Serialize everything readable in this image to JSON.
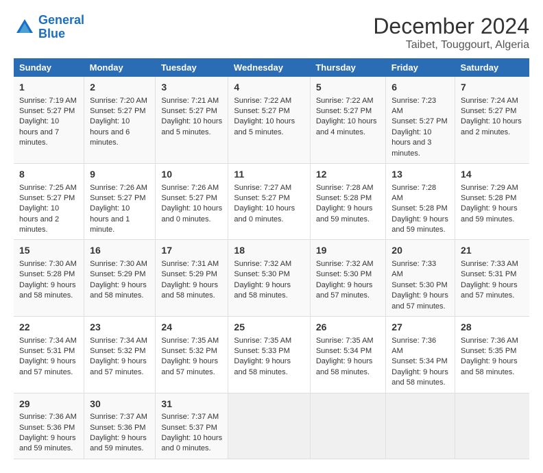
{
  "header": {
    "logo_line1": "General",
    "logo_line2": "Blue",
    "title": "December 2024",
    "subtitle": "Taibet, Touggourt, Algeria"
  },
  "days_of_week": [
    "Sunday",
    "Monday",
    "Tuesday",
    "Wednesday",
    "Thursday",
    "Friday",
    "Saturday"
  ],
  "weeks": [
    [
      {
        "day": "1",
        "sunrise": "7:19 AM",
        "sunset": "5:27 PM",
        "daylight": "10 hours and 7 minutes."
      },
      {
        "day": "2",
        "sunrise": "7:20 AM",
        "sunset": "5:27 PM",
        "daylight": "10 hours and 6 minutes."
      },
      {
        "day": "3",
        "sunrise": "7:21 AM",
        "sunset": "5:27 PM",
        "daylight": "10 hours and 5 minutes."
      },
      {
        "day": "4",
        "sunrise": "7:22 AM",
        "sunset": "5:27 PM",
        "daylight": "10 hours and 5 minutes."
      },
      {
        "day": "5",
        "sunrise": "7:22 AM",
        "sunset": "5:27 PM",
        "daylight": "10 hours and 4 minutes."
      },
      {
        "day": "6",
        "sunrise": "7:23 AM",
        "sunset": "5:27 PM",
        "daylight": "10 hours and 3 minutes."
      },
      {
        "day": "7",
        "sunrise": "7:24 AM",
        "sunset": "5:27 PM",
        "daylight": "10 hours and 2 minutes."
      }
    ],
    [
      {
        "day": "8",
        "sunrise": "7:25 AM",
        "sunset": "5:27 PM",
        "daylight": "10 hours and 2 minutes."
      },
      {
        "day": "9",
        "sunrise": "7:26 AM",
        "sunset": "5:27 PM",
        "daylight": "10 hours and 1 minute."
      },
      {
        "day": "10",
        "sunrise": "7:26 AM",
        "sunset": "5:27 PM",
        "daylight": "10 hours and 0 minutes."
      },
      {
        "day": "11",
        "sunrise": "7:27 AM",
        "sunset": "5:27 PM",
        "daylight": "10 hours and 0 minutes."
      },
      {
        "day": "12",
        "sunrise": "7:28 AM",
        "sunset": "5:28 PM",
        "daylight": "9 hours and 59 minutes."
      },
      {
        "day": "13",
        "sunrise": "7:28 AM",
        "sunset": "5:28 PM",
        "daylight": "9 hours and 59 minutes."
      },
      {
        "day": "14",
        "sunrise": "7:29 AM",
        "sunset": "5:28 PM",
        "daylight": "9 hours and 59 minutes."
      }
    ],
    [
      {
        "day": "15",
        "sunrise": "7:30 AM",
        "sunset": "5:28 PM",
        "daylight": "9 hours and 58 minutes."
      },
      {
        "day": "16",
        "sunrise": "7:30 AM",
        "sunset": "5:29 PM",
        "daylight": "9 hours and 58 minutes."
      },
      {
        "day": "17",
        "sunrise": "7:31 AM",
        "sunset": "5:29 PM",
        "daylight": "9 hours and 58 minutes."
      },
      {
        "day": "18",
        "sunrise": "7:32 AM",
        "sunset": "5:30 PM",
        "daylight": "9 hours and 58 minutes."
      },
      {
        "day": "19",
        "sunrise": "7:32 AM",
        "sunset": "5:30 PM",
        "daylight": "9 hours and 57 minutes."
      },
      {
        "day": "20",
        "sunrise": "7:33 AM",
        "sunset": "5:30 PM",
        "daylight": "9 hours and 57 minutes."
      },
      {
        "day": "21",
        "sunrise": "7:33 AM",
        "sunset": "5:31 PM",
        "daylight": "9 hours and 57 minutes."
      }
    ],
    [
      {
        "day": "22",
        "sunrise": "7:34 AM",
        "sunset": "5:31 PM",
        "daylight": "9 hours and 57 minutes."
      },
      {
        "day": "23",
        "sunrise": "7:34 AM",
        "sunset": "5:32 PM",
        "daylight": "9 hours and 57 minutes."
      },
      {
        "day": "24",
        "sunrise": "7:35 AM",
        "sunset": "5:32 PM",
        "daylight": "9 hours and 57 minutes."
      },
      {
        "day": "25",
        "sunrise": "7:35 AM",
        "sunset": "5:33 PM",
        "daylight": "9 hours and 58 minutes."
      },
      {
        "day": "26",
        "sunrise": "7:35 AM",
        "sunset": "5:34 PM",
        "daylight": "9 hours and 58 minutes."
      },
      {
        "day": "27",
        "sunrise": "7:36 AM",
        "sunset": "5:34 PM",
        "daylight": "9 hours and 58 minutes."
      },
      {
        "day": "28",
        "sunrise": "7:36 AM",
        "sunset": "5:35 PM",
        "daylight": "9 hours and 58 minutes."
      }
    ],
    [
      {
        "day": "29",
        "sunrise": "7:36 AM",
        "sunset": "5:36 PM",
        "daylight": "9 hours and 59 minutes."
      },
      {
        "day": "30",
        "sunrise": "7:37 AM",
        "sunset": "5:36 PM",
        "daylight": "9 hours and 59 minutes."
      },
      {
        "day": "31",
        "sunrise": "7:37 AM",
        "sunset": "5:37 PM",
        "daylight": "10 hours and 0 minutes."
      },
      null,
      null,
      null,
      null
    ]
  ],
  "labels": {
    "sunrise": "Sunrise:",
    "sunset": "Sunset:",
    "daylight": "Daylight:"
  }
}
